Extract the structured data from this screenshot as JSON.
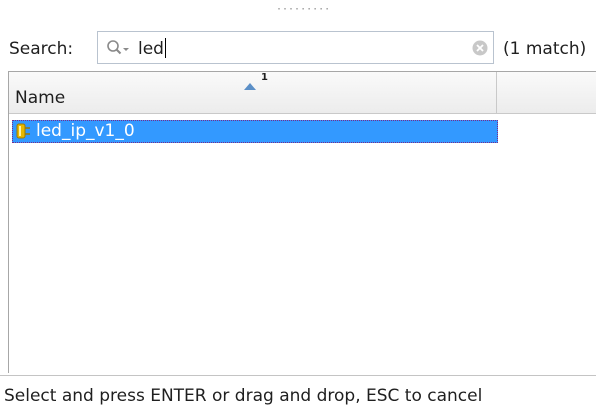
{
  "search": {
    "label": "Search:",
    "value": "led",
    "match_count": "(1 match)"
  },
  "table": {
    "column_header": "Name",
    "sort_index": "1",
    "sort_direction": "ascending",
    "rows": [
      {
        "label": "led_ip_v1_0",
        "selected": true,
        "icon": "ip-core-icon"
      }
    ]
  },
  "status": {
    "text": "Select and press ENTER or drag and drop, ESC to cancel"
  },
  "colors": {
    "selection": "#3399ff",
    "selection_text": "#ffffff",
    "header_bg": "#f0f0f0",
    "ip_icon": "#e8b800"
  }
}
